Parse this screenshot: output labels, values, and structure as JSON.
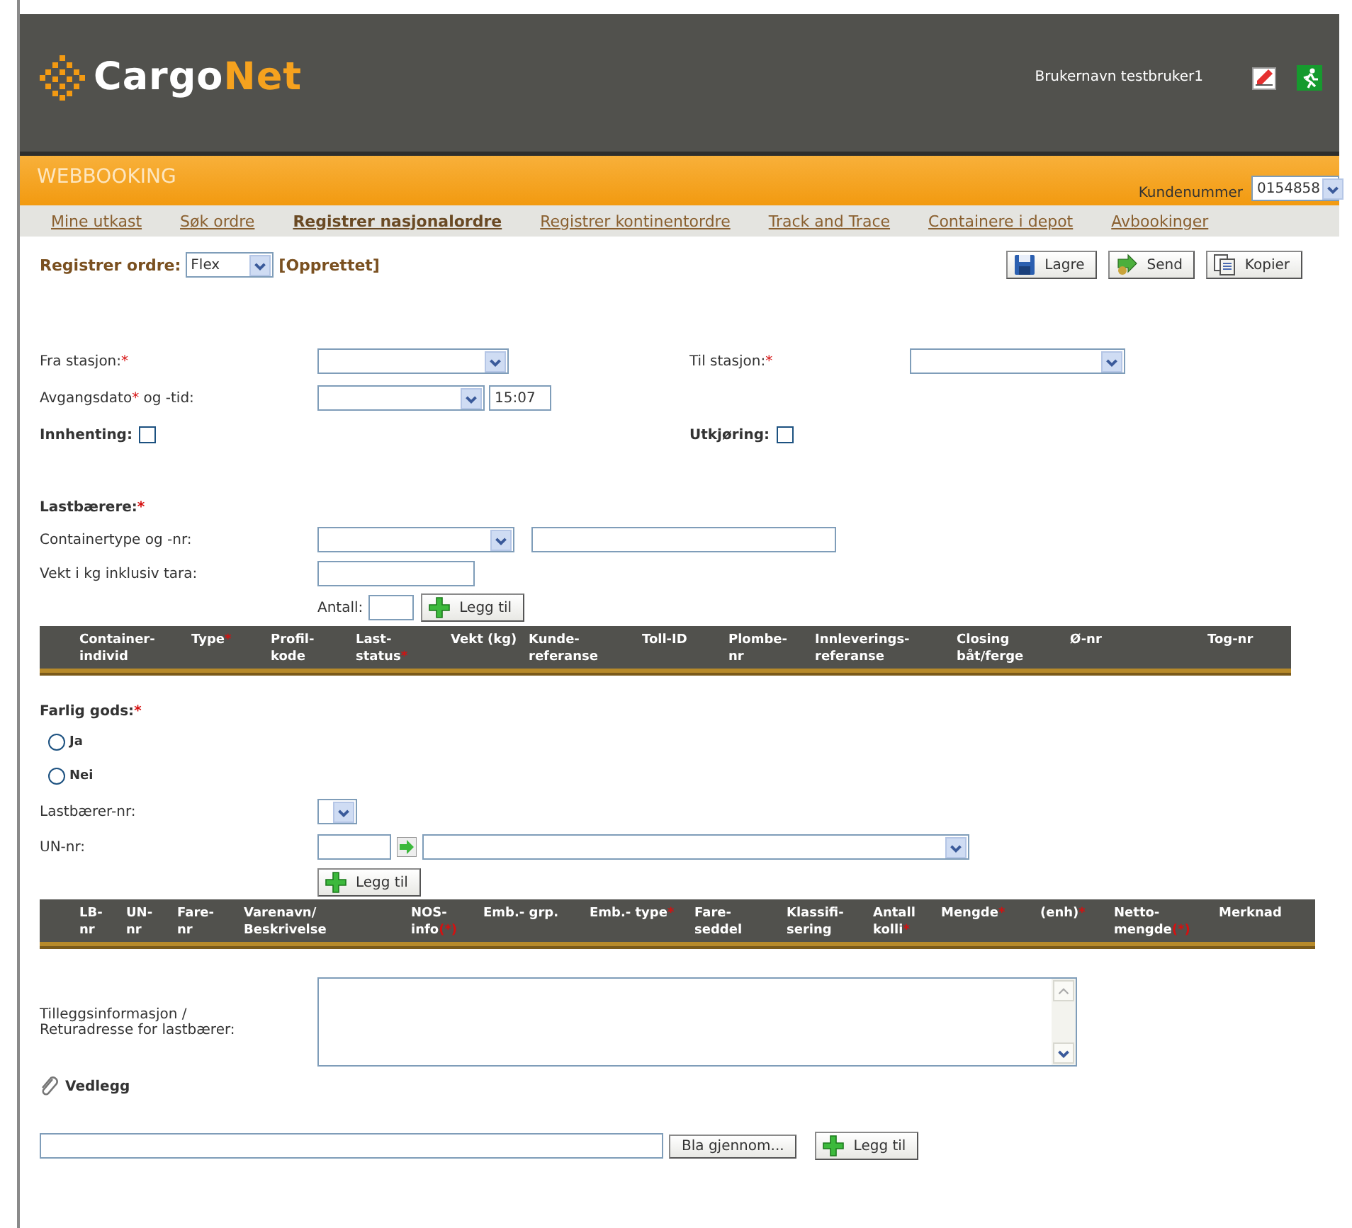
{
  "header": {
    "logo": [
      {
        "text": "Cargo",
        "accent": false
      },
      {
        "text": "Net",
        "accent": true
      }
    ],
    "username": "Brukernavn testbruker1"
  },
  "banner": {
    "title": "WEBBOOKING",
    "customer_label": "Kundenummer",
    "customer_value": "0154858"
  },
  "nav": [
    {
      "label": "Mine utkast",
      "selected": false
    },
    {
      "label": "Søk ordre",
      "selected": false
    },
    {
      "label": "Registrer nasjonalordre",
      "selected": true
    },
    {
      "label": "Registrer kontinentordre",
      "selected": false
    },
    {
      "label": "Track and Trace",
      "selected": false
    },
    {
      "label": "Containere i depot",
      "selected": false
    },
    {
      "label": "Avbookinger",
      "selected": false
    }
  ],
  "order_bar": {
    "label": "Registrer ordre:",
    "type_value": "Flex",
    "status": "[Opprettet]",
    "actions": [
      {
        "kind": "save",
        "label": "Lagre"
      },
      {
        "kind": "send",
        "label": "Send"
      },
      {
        "kind": "copy",
        "label": "Kopier"
      }
    ]
  },
  "route": {
    "from_label": [
      {
        "text": "Fra stasjon:",
        "required": false
      },
      {
        "text": "*",
        "required": true
      }
    ],
    "to_label": [
      {
        "text": "Til stasjon:",
        "required": false
      },
      {
        "text": "*",
        "required": true
      }
    ],
    "date_label": [
      {
        "text": "Avgangsdato",
        "required": false
      },
      {
        "text": "*",
        "required": true
      },
      {
        "text": " og -tid:",
        "required": false
      }
    ],
    "time_value": "15:07",
    "pickup": {
      "label": "Innhenting:",
      "checked": false
    },
    "delivery": {
      "label": "Utkjøring:",
      "checked": false
    }
  },
  "carriers": {
    "title": [
      {
        "text": "Lastbærere:",
        "required": false
      },
      {
        "text": "*",
        "required": true
      }
    ],
    "type_label": "Containertype og -nr:",
    "weight_label": "Vekt i kg inklusiv tara:",
    "count_label": "Antall:",
    "add_button": "Legg til",
    "columns": [
      [
        {
          "text": "Container-\nindivid",
          "required": false
        }
      ],
      [
        {
          "text": "Type",
          "required": false
        },
        {
          "text": "*",
          "required": true
        }
      ],
      [
        {
          "text": "Profil-\nkode",
          "required": false
        }
      ],
      [
        {
          "text": "Last-\nstatus",
          "required": false
        },
        {
          "text": "*",
          "required": true
        }
      ],
      [
        {
          "text": "Vekt (kg)",
          "required": false
        }
      ],
      [
        {
          "text": "Kunde-\nreferanse",
          "required": false
        }
      ],
      [
        {
          "text": "Toll-ID",
          "required": false
        }
      ],
      [
        {
          "text": "Plombe-\nnr",
          "required": false
        }
      ],
      [
        {
          "text": "Innleverings-\nreferanse",
          "required": false
        }
      ],
      [
        {
          "text": "Closing\nbåt/ferge",
          "required": false
        }
      ],
      [
        {
          "text": "Ø-nr",
          "required": false
        }
      ],
      [
        {
          "text": "Tog-nr",
          "required": false
        }
      ]
    ]
  },
  "dangerous": {
    "title": [
      {
        "text": "Farlig gods:",
        "required": false
      },
      {
        "text": "*",
        "required": true
      }
    ],
    "options": [
      {
        "label": "Ja",
        "selected": false
      },
      {
        "label": "Nei",
        "selected": false
      }
    ],
    "carrier_label": "Lastbærer-nr:",
    "un_label": "UN-nr:",
    "add_button": "Legg til",
    "columns": [
      [
        {
          "text": "LB-\nnr",
          "required": false
        }
      ],
      [
        {
          "text": "UN-\nnr",
          "required": false
        }
      ],
      [
        {
          "text": "Fare-\nnr",
          "required": false
        }
      ],
      [
        {
          "text": "Varenavn/\nBeskrivelse",
          "required": false
        }
      ],
      [
        {
          "text": "NOS-\ninfo",
          "required": false
        },
        {
          "text": "(*)",
          "required": true
        }
      ],
      [
        {
          "text": "Emb.- grp.",
          "required": false
        }
      ],
      [
        {
          "text": "Emb.- type",
          "required": false
        },
        {
          "text": "*",
          "required": true
        }
      ],
      [
        {
          "text": "Fare-\nseddel",
          "required": false
        }
      ],
      [
        {
          "text": "Klassifi-\nsering",
          "required": false
        }
      ],
      [
        {
          "text": "Antall\nkolli",
          "required": false
        },
        {
          "text": "*",
          "required": true
        }
      ],
      [
        {
          "text": "Mengde",
          "required": false
        },
        {
          "text": "*",
          "required": true
        }
      ],
      [
        {
          "text": "(enh)",
          "required": false
        },
        {
          "text": "*",
          "required": true
        }
      ],
      [
        {
          "text": "Netto-\nmengde",
          "required": false
        },
        {
          "text": "(*)",
          "required": true
        }
      ],
      [
        {
          "text": "Merknad",
          "required": false
        }
      ]
    ]
  },
  "extra": {
    "label": "Tilleggsinformasjon /\nReturadresse for lastbærer:"
  },
  "attachment": {
    "title": "Vedlegg",
    "browse_button": "Bla gjennom...",
    "add_button": "Legg til"
  }
}
